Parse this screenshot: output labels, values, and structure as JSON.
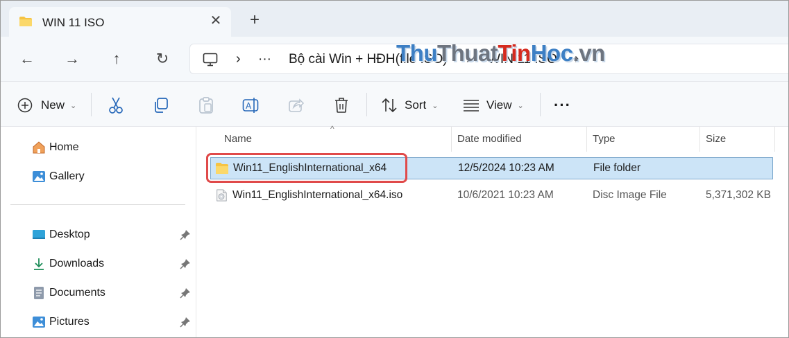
{
  "window": {
    "tab_title": "WIN 11 ISO",
    "tab_close": "✕",
    "new_tab": "+"
  },
  "nav": {
    "back": "←",
    "forward": "→",
    "up": "↑",
    "refresh": "↻"
  },
  "address": {
    "overflow": "···",
    "sep": "›",
    "crumbs": [
      "Bộ cài Win + HĐH(file ISO)",
      "WIN 11 ISO"
    ]
  },
  "watermark": {
    "part1": "Thu",
    "part2": "Thuat",
    "part3": "Tin",
    "part4": "Hoc",
    "part5": ".vn"
  },
  "toolbar": {
    "new_label": "New",
    "sort_label": "Sort",
    "view_label": "View",
    "more_label": "···",
    "caret": "⌄"
  },
  "sidebar": {
    "items": [
      {
        "label": "Home",
        "icon": "home-icon"
      },
      {
        "label": "Gallery",
        "icon": "gallery-icon"
      },
      {
        "label": "Desktop",
        "icon": "desktop-icon",
        "pinned": true
      },
      {
        "label": "Downloads",
        "icon": "download-icon",
        "pinned": true
      },
      {
        "label": "Documents",
        "icon": "documents-icon",
        "pinned": true
      },
      {
        "label": "Pictures",
        "icon": "pictures-icon",
        "pinned": true
      }
    ]
  },
  "table": {
    "sort_indicator": "^",
    "columns": [
      "Name",
      "Date modified",
      "Type",
      "Size"
    ],
    "rows": [
      {
        "name": "Win11_EnglishInternational_x64",
        "date": "12/5/2024 10:23 AM",
        "type": "File folder",
        "size": "",
        "icon": "folder-icon",
        "selected": true
      },
      {
        "name": "Win11_EnglishInternational_x64.iso",
        "date": "10/6/2021 10:23 AM",
        "type": "Disc Image File",
        "size": "5,371,302 KB",
        "icon": "disc-image-icon",
        "selected": false
      }
    ]
  },
  "colors": {
    "selection": "#cce4f7",
    "highlight": "#e04a4a",
    "folder": "#f6c343"
  }
}
